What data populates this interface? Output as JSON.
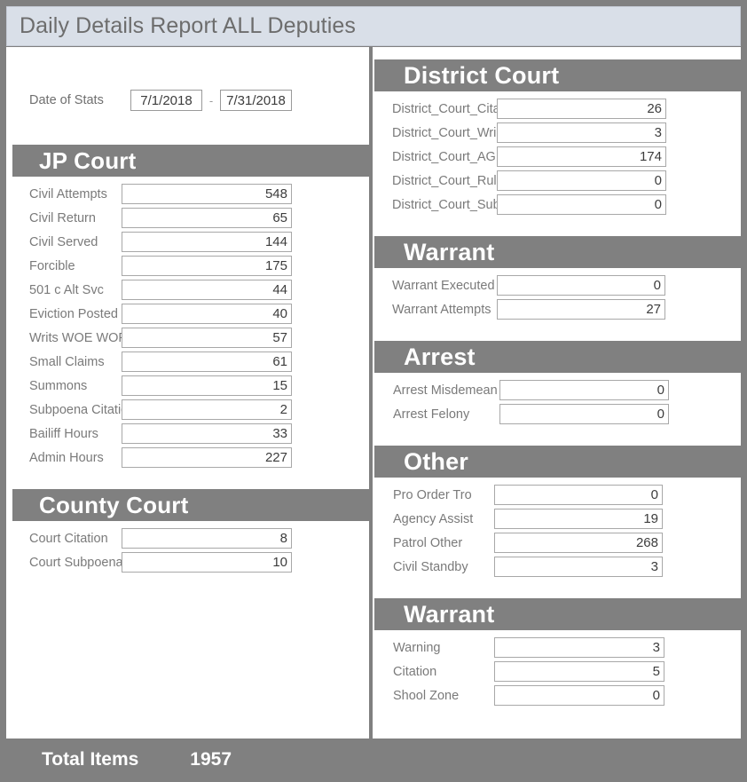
{
  "window": {
    "title": "Daily Details Report ALL Deputies"
  },
  "date_filter": {
    "label": "Date of Stats",
    "start": "7/1/2018",
    "separator": "-",
    "end": "7/31/2018"
  },
  "sections": {
    "jp_court": {
      "title": "JP Court",
      "fields": [
        {
          "label": "Civil Attempts",
          "value": "548"
        },
        {
          "label": "Civil Return",
          "value": "65"
        },
        {
          "label": "Civil Served",
          "value": "144"
        },
        {
          "label": "Forcible",
          "value": "175"
        },
        {
          "label": "501 c Alt Svc",
          "value": "44"
        },
        {
          "label": "Eviction Posted",
          "value": "40"
        },
        {
          "label": "Writs WOE WOP",
          "value": "57"
        },
        {
          "label": "Small Claims",
          "value": "61"
        },
        {
          "label": "Summons",
          "value": "15"
        },
        {
          "label": "Subpoena Citation",
          "value": "2"
        },
        {
          "label": "Bailiff Hours",
          "value": "33"
        },
        {
          "label": "Admin Hours",
          "value": "227"
        }
      ]
    },
    "county_court": {
      "title": "County Court",
      "fields": [
        {
          "label": "Court Citation",
          "value": "8"
        },
        {
          "label": "Court Subpoena",
          "value": "10"
        }
      ]
    },
    "district_court": {
      "title": "District Court",
      "fields": [
        {
          "label": "District_Court_Cita",
          "value": "26"
        },
        {
          "label": "District_Court_Wri",
          "value": "3"
        },
        {
          "label": "District_Court_AG",
          "value": "174"
        },
        {
          "label": "District_Court_Rul",
          "value": "0"
        },
        {
          "label": "District_Court_Sub",
          "value": "0"
        }
      ]
    },
    "warrant": {
      "title": "Warrant",
      "fields": [
        {
          "label": "Warrant Executed",
          "value": "0"
        },
        {
          "label": "Warrant Attempts",
          "value": "27"
        }
      ]
    },
    "arrest": {
      "title": "Arrest",
      "fields": [
        {
          "label": "Arrest Misdemean",
          "value": "0"
        },
        {
          "label": "Arrest Felony",
          "value": "0"
        }
      ]
    },
    "other": {
      "title": "Other",
      "fields": [
        {
          "label": "Pro Order Tro",
          "value": "0"
        },
        {
          "label": "Agency Assist",
          "value": "19"
        },
        {
          "label": "Patrol Other",
          "value": "268"
        },
        {
          "label": "Civil Standby",
          "value": "3"
        }
      ]
    },
    "warrant2": {
      "title": "Warrant",
      "fields": [
        {
          "label": "Warning",
          "value": "3"
        },
        {
          "label": "Citation",
          "value": "5"
        },
        {
          "label": "Shool Zone",
          "value": "0"
        }
      ]
    }
  },
  "footer": {
    "label": "Total Items",
    "value": "1957"
  },
  "colors": {
    "titlebar_bg": "#d9dfe8",
    "section_header_bg": "#808080",
    "page_border": "#808080",
    "label_text": "#7a7a7a",
    "value_text": "#3c3c3c"
  }
}
